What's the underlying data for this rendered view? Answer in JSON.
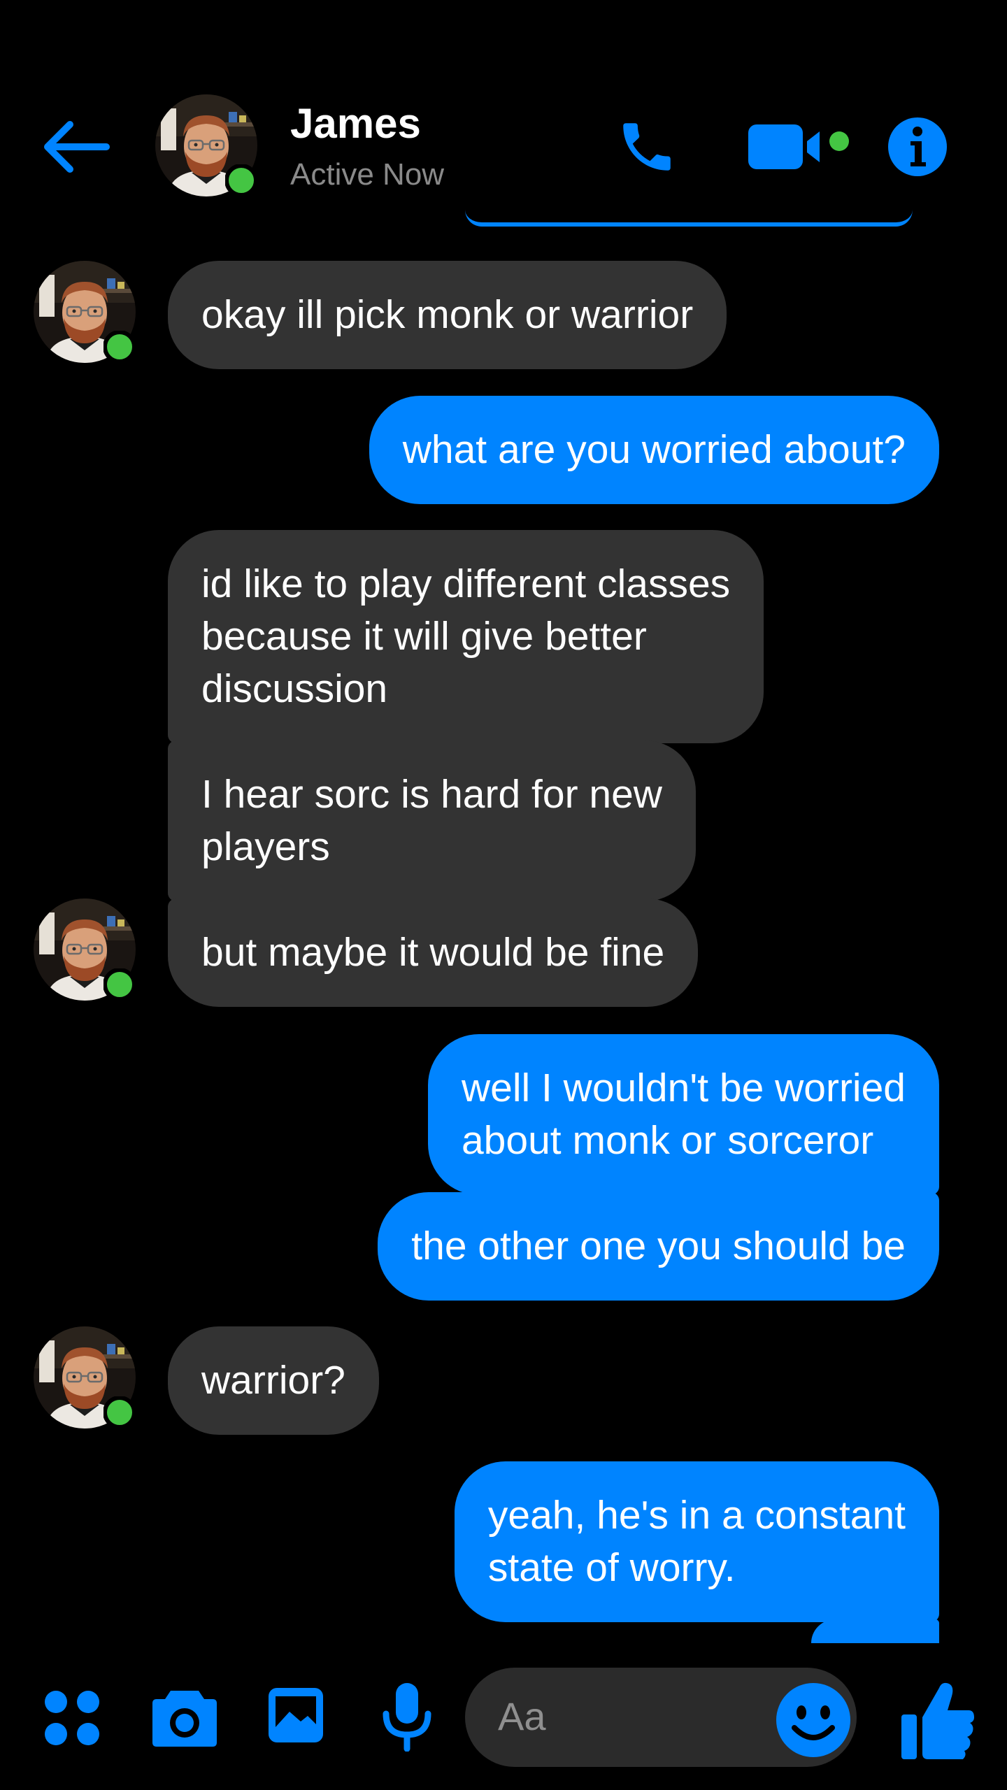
{
  "header": {
    "name": "James",
    "status": "Active Now"
  },
  "messages": [
    {
      "dir": "in",
      "text": "okay ill pick monk or warrior"
    },
    {
      "dir": "out",
      "text": "what are you worried about?"
    },
    {
      "dir": "in",
      "lines": [
        "id like to play different classes",
        "because it will give better",
        "discussion"
      ]
    },
    {
      "dir": "in",
      "lines": [
        "I hear sorc is hard for new",
        "players"
      ]
    },
    {
      "dir": "in",
      "text": "but maybe it would be fine"
    },
    {
      "dir": "out",
      "lines": [
        "well I wouldn't be worried",
        "about monk or sorceror"
      ]
    },
    {
      "dir": "out",
      "text": "the other one you should be"
    },
    {
      "dir": "in",
      "text": "warrior?"
    },
    {
      "dir": "out",
      "lines": [
        "yeah, he's in a constant",
        "state of worry."
      ]
    }
  ],
  "composer": {
    "placeholder": "Aa"
  },
  "icons": {
    "back": "arrow-left-icon",
    "call": "phone-icon",
    "video": "video-camera-icon",
    "info": "info-icon",
    "menu": "four-dots-icon",
    "camera": "camera-icon",
    "gallery": "image-icon",
    "mic": "microphone-icon",
    "emoji": "smiley-icon",
    "like": "thumbs-up-icon"
  },
  "colors": {
    "accent": "#0084ff",
    "incoming_bubble": "#333333",
    "online": "#44c543",
    "background": "#000000"
  }
}
